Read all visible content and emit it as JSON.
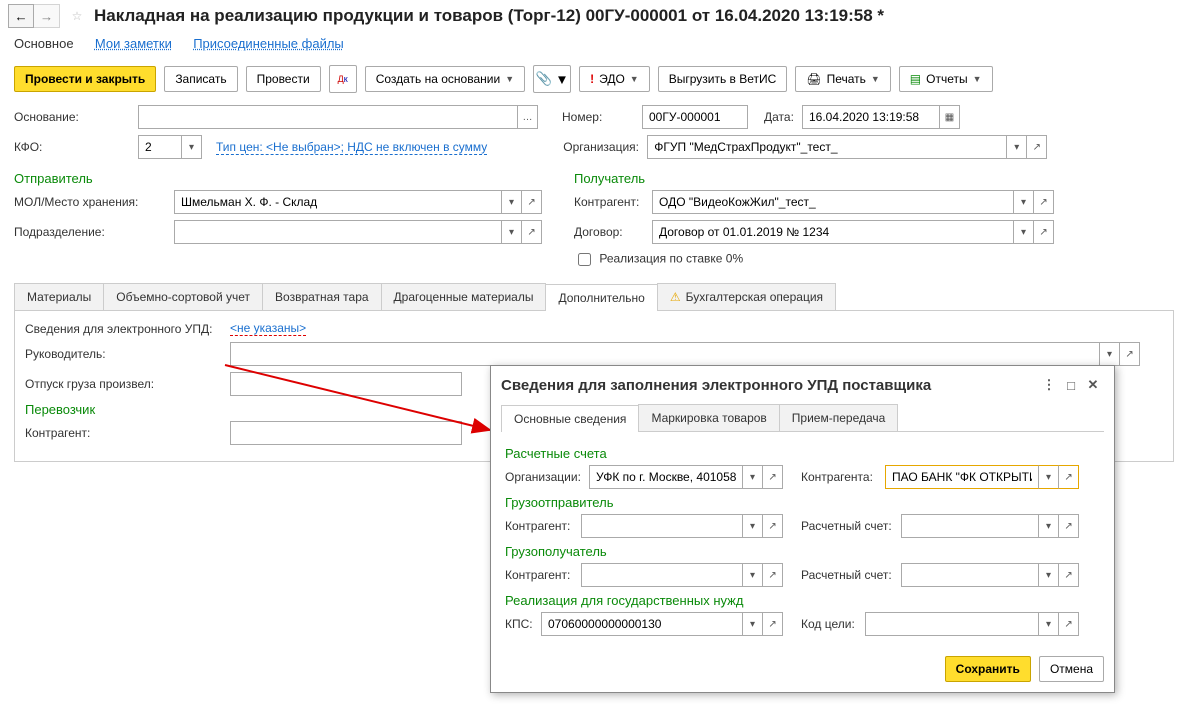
{
  "header": {
    "title": "Накладная на реализацию продукции и товаров (Торг-12) 00ГУ-000001 от 16.04.2020 13:19:58 *"
  },
  "nav_tabs": {
    "main": "Основное",
    "notes": "Мои заметки",
    "files": "Присоединенные файлы"
  },
  "toolbar": {
    "post_close": "Провести и закрыть",
    "save": "Записать",
    "post": "Провести",
    "create_based": "Создать на основании",
    "edo": "ЭДО",
    "vetis": "Выгрузить в ВетИС",
    "print": "Печать",
    "reports": "Отчеты"
  },
  "form": {
    "basis_lbl": "Основание:",
    "basis_val": "",
    "number_lbl": "Номер:",
    "number_val": "00ГУ-000001",
    "date_lbl": "Дата:",
    "date_val": "16.04.2020 13:19:58",
    "kfo_lbl": "КФО:",
    "kfo_val": "2",
    "price_type_link": "Тип цен: <Не выбран>; НДС не включен в сумму",
    "org_lbl": "Организация:",
    "org_val": "ФГУП \"МедСтрахПродукт\"_тест_"
  },
  "sender": {
    "title": "Отправитель",
    "mol_lbl": "МОЛ/Место хранения:",
    "mol_val": "Шмельман Х. Ф. - Склад",
    "dept_lbl": "Подразделение:",
    "dept_val": ""
  },
  "receiver": {
    "title": "Получатель",
    "contr_lbl": "Контрагент:",
    "contr_val": "ОДО \"ВидеоКожЖил\"_тест_",
    "contract_lbl": "Договор:",
    "contract_val": "Договор от 01.01.2019 № 1234",
    "zero_rate": "Реализация по ставке 0%"
  },
  "sub_tabs": {
    "materials": "Материалы",
    "volumetric": "Объемно-сортовой учет",
    "returnable": "Возвратная тара",
    "precious": "Драгоценные материалы",
    "extra": "Дополнительно",
    "accounting": "Бухгалтерская операция"
  },
  "extra_panel": {
    "upd_lbl": "Сведения для электронного УПД:",
    "upd_link": "<не указаны>",
    "head_lbl": "Руководитель:",
    "release_lbl": "Отпуск груза произвел:",
    "carrier_title": "Перевозчик",
    "carrier_contr_lbl": "Контрагент:"
  },
  "dialog": {
    "title": "Сведения для заполнения электронного УПД поставщика",
    "tabs": {
      "main": "Основные сведения",
      "mark": "Маркировка товаров",
      "transfer": "Прием-передача"
    },
    "accounts": {
      "title": "Расчетные счета",
      "org_lbl": "Организации:",
      "org_val": "УФК по г. Москве, 401058",
      "contr_lbl": "Контрагента:",
      "contr_val": "ПАО БАНК \"ФК ОТКРЫТИ"
    },
    "consignor": {
      "title": "Грузоотправитель",
      "contr_lbl": "Контрагент:",
      "contr_val": "",
      "acct_lbl": "Расчетный счет:",
      "acct_val": ""
    },
    "consignee": {
      "title": "Грузополучатель",
      "contr_lbl": "Контрагент:",
      "contr_val": "",
      "acct_lbl": "Расчетный счет:",
      "acct_val": ""
    },
    "gov": {
      "title": "Реализация для государственных нужд",
      "kps_lbl": "КПС:",
      "kps_val": "07060000000000130",
      "goal_lbl": "Код цели:",
      "goal_val": ""
    },
    "footer": {
      "save": "Сохранить",
      "cancel": "Отмена"
    }
  }
}
